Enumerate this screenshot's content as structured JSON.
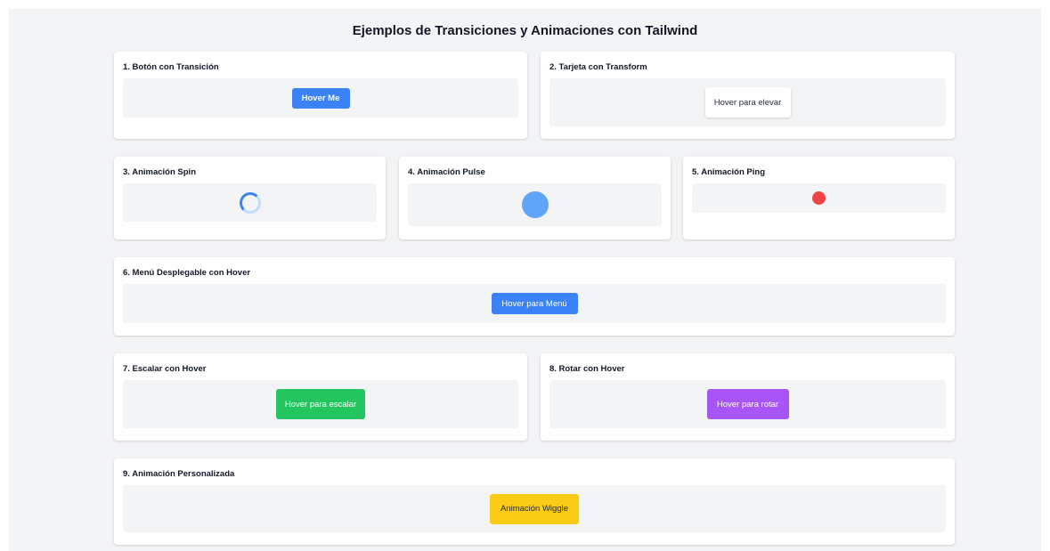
{
  "page": {
    "title": "Ejemplos de Transiciones y Animaciones con Tailwind"
  },
  "cards": {
    "c1": {
      "title": "1. Botón con Transición",
      "button_label": "Hover Me"
    },
    "c2": {
      "title": "2. Tarjeta con Transform",
      "button_label": "Hover para elevar"
    },
    "c3": {
      "title": "3. Animación Spin",
      "icon": "spinner-icon"
    },
    "c4": {
      "title": "4. Animación Pulse",
      "icon": "pulse-dot"
    },
    "c5": {
      "title": "5. Animación Ping",
      "icon": "ping-dot"
    },
    "c6": {
      "title": "6. Menú Desplegable con Hover",
      "button_label": "Hover para Menú"
    },
    "c7": {
      "title": "7. Escalar con Hover",
      "button_label": "Hover para escalar"
    },
    "c8": {
      "title": "8. Rotar con Hover",
      "button_label": "Hover para rotar"
    },
    "c9": {
      "title": "9. Animación Personalizada",
      "button_label": "Animación Wiggle"
    }
  },
  "colors": {
    "blue": "#3b82f6",
    "light_blue": "#60a5fa",
    "red": "#ef4444",
    "green": "#22c55e",
    "purple": "#a855f7",
    "yellow": "#facc15",
    "background": "#f3f4f6"
  }
}
